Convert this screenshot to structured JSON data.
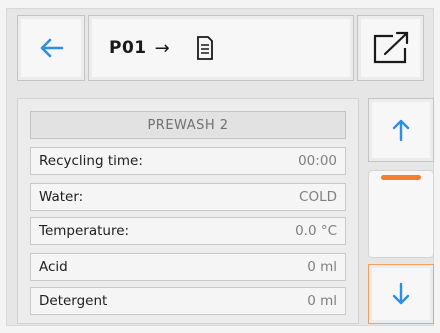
{
  "header": {
    "program": "P01",
    "arrow": "→"
  },
  "section": {
    "title": "PREWASH 2"
  },
  "rows": [
    {
      "label": "Recycling time:",
      "value": "00:00"
    },
    {
      "label": "Water:",
      "value": "COLD"
    },
    {
      "label": "Temperature:",
      "value": "0.0 °C"
    },
    {
      "label": "Acid",
      "value": "0 ml"
    },
    {
      "label": "Detergent",
      "value": "0 ml"
    }
  ],
  "icons": {
    "back": "arrow-left-icon",
    "document": "document-icon",
    "exit": "exit-arrow-icon",
    "up": "arrow-up-icon",
    "down": "arrow-down-icon"
  },
  "colors": {
    "accent": "#2b8ee8",
    "scroll_thumb": "#f27f2e",
    "down_border": "#f3a060"
  }
}
